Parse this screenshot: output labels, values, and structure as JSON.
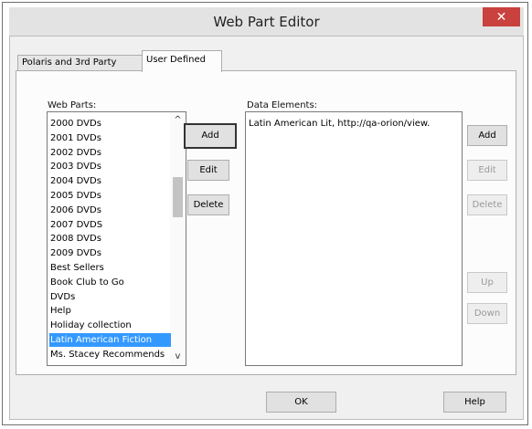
{
  "window": {
    "title": "Web Part Editor",
    "close_label": "✕"
  },
  "tabs": [
    {
      "label": "Polaris and 3rd Party",
      "active": false
    },
    {
      "label": "User Defined",
      "active": true
    }
  ],
  "web_parts": {
    "label": "Web Parts:",
    "items": [
      "2000 DVDs",
      "2001 DVDs",
      "2002 DVDs",
      "2003 DVDs",
      "2004 DVDs",
      "2005 DVDs",
      "2006 DVDs",
      "2007 DVDS",
      "2008 DVDs",
      "2009 DVDs",
      "Best Sellers",
      "Book Club to Go",
      "DVDs",
      "Help",
      "Holiday collection",
      "Latin American Fiction",
      "Ms. Stacey Recommends"
    ],
    "selected": "Latin American Fiction",
    "scroll_up": "^",
    "scroll_down": "v"
  },
  "web_parts_buttons": {
    "add": "Add",
    "edit": "Edit",
    "delete": "Delete"
  },
  "data_elements": {
    "label": "Data Elements:",
    "items": [
      "Latin American Lit, http://qa-orion/view."
    ]
  },
  "data_elements_buttons": {
    "add": "Add",
    "edit": "Edit",
    "delete": "Delete",
    "up": "Up",
    "down": "Down"
  },
  "footer": {
    "ok": "OK",
    "help": "Help"
  }
}
